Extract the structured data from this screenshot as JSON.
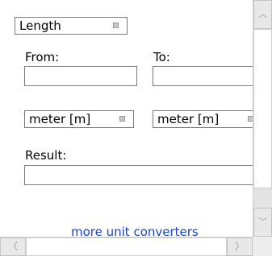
{
  "converter": {
    "category_selected": "Length",
    "from_label": "From:",
    "to_label": "To:",
    "from_value": "",
    "to_value": "",
    "from_unit_selected": "meter [m]",
    "to_unit_selected": "meter [m]",
    "result_label": "Result:",
    "result_value": "",
    "more_link": "more unit converters"
  },
  "scrollbars": {
    "up_arrow": "︿",
    "down_arrow": "﹀",
    "left_arrow": "〈",
    "right_arrow": "〉"
  }
}
